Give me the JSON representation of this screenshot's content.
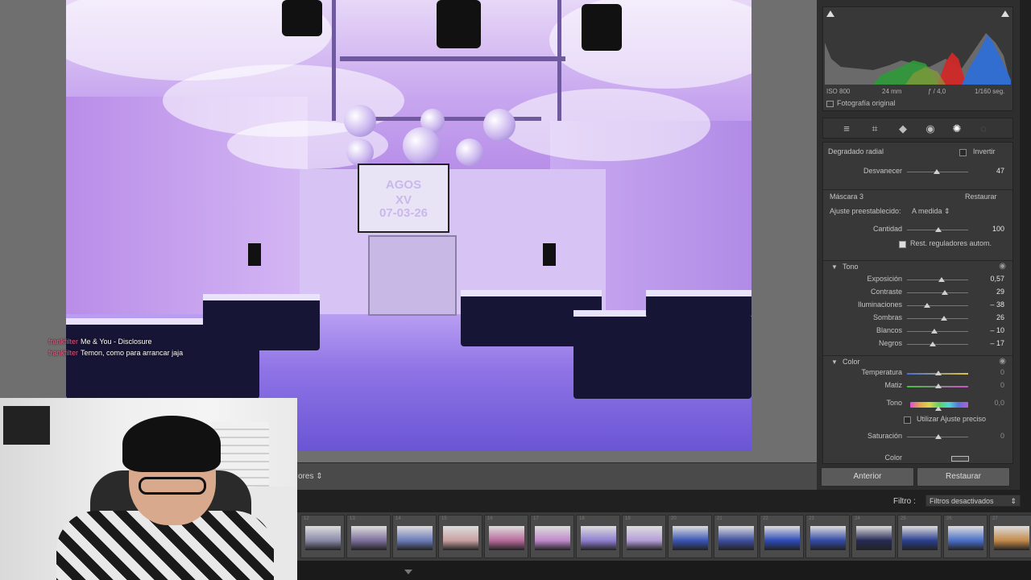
{
  "photo": {
    "screen_text_1": "AGOS",
    "screen_text_2": "XV",
    "screen_text_3": "07-03-26"
  },
  "chat": [
    {
      "user": "frankfilter",
      "message": "Me & You - Disclosure"
    },
    {
      "user": "frankfilter",
      "message": "Temon, como para arrancar jaja"
    }
  ],
  "toolbar": {
    "sort_label": "ores",
    "sort_arrow": "⇕"
  },
  "histogram": {
    "iso": "ISO 800",
    "focal": "24 mm",
    "aperture": "ƒ / 4,0",
    "shutter": "1/160 seg.",
    "original_label": "Fotografía original"
  },
  "tools": [
    "sliders-icon",
    "crop-icon",
    "eraser-icon",
    "redeye-icon",
    "mask-icon",
    "circle-icon"
  ],
  "mask": {
    "radial_label": "Degradado radial",
    "invert_label": "Invertir",
    "feather_label": "Desvanecer",
    "feather_value": "47",
    "mask_name": "Máscara 3",
    "reset_label": "Restaurar",
    "preset_label": "Ajuste preestablecido:",
    "preset_value": "A medida",
    "amount_label": "Cantidad",
    "amount_value": "100",
    "auto_reset_label": "Rest. reguladores autom.",
    "tone_title": "Tono",
    "tone_sliders": [
      {
        "label": "Exposición",
        "value": "0,57",
        "pos": 0.57
      },
      {
        "label": "Contraste",
        "value": "29",
        "pos": 0.62
      },
      {
        "label": "Iluminaciones",
        "value": "– 38",
        "pos": 0.33
      },
      {
        "label": "Sombras",
        "value": "26",
        "pos": 0.61
      },
      {
        "label": "Blancos",
        "value": "– 10",
        "pos": 0.45
      },
      {
        "label": "Negros",
        "value": "– 17",
        "pos": 0.42
      }
    ],
    "color_title": "Color",
    "temp_label": "Temperatura",
    "temp_value": "0",
    "tint_label": "Matiz",
    "tint_value": "0",
    "hue_label": "Tono",
    "hue_value": "0,0",
    "fine_label": "Utilizar Ajuste preciso",
    "saturation_label": "Saturación",
    "saturation_value": "0",
    "color_label": "Color"
  },
  "buttons": {
    "previous": "Anterior",
    "reset": "Restaurar"
  },
  "filmstrip": {
    "filter_label": "Filtro :",
    "filter_value": "Filtros desactivados",
    "frames": [
      {
        "num": "12",
        "tone": "#8a8aa8"
      },
      {
        "num": "13",
        "tone": "#7d6f9a"
      },
      {
        "num": "14",
        "tone": "#6b7bb8"
      },
      {
        "num": "15",
        "tone": "#c9a0a0"
      },
      {
        "num": "16",
        "tone": "#b76b9a"
      },
      {
        "num": "17",
        "tone": "#c08acb"
      },
      {
        "num": "18",
        "tone": "#8f7fd0"
      },
      {
        "num": "19",
        "tone": "#b59ed8"
      },
      {
        "num": "20",
        "tone": "#3a55b5"
      },
      {
        "num": "21",
        "tone": "#3c4e9e"
      },
      {
        "num": "22",
        "tone": "#2e4bb8"
      },
      {
        "num": "23",
        "tone": "#334aa6"
      },
      {
        "num": "24",
        "tone": "#262a55"
      },
      {
        "num": "25",
        "tone": "#2a3f8f"
      },
      {
        "num": "26",
        "tone": "#4a6fc7"
      },
      {
        "num": "27",
        "tone": "#c48a4a"
      }
    ]
  }
}
